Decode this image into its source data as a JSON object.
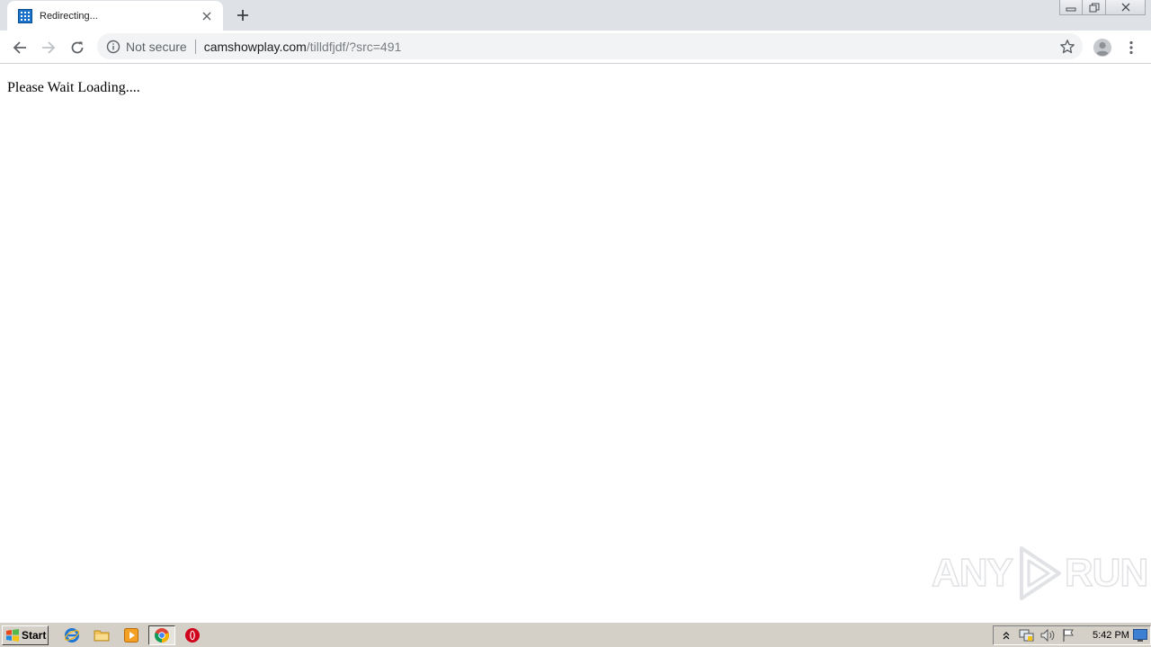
{
  "browser": {
    "tab": {
      "title": "Redirecting...",
      "favicon": "grid-favicon-icon"
    },
    "new_tab_icon": "plus-icon",
    "window_controls": [
      "minimize-icon",
      "restore-icon",
      "close-icon"
    ],
    "toolbar": {
      "back_icon": "arrow-left-icon",
      "forward_icon": "arrow-right-icon",
      "reload_icon": "reload-icon",
      "security_label": "Not secure",
      "url_host": "camshowplay.com",
      "url_path": "/tilldfjdf/?src=491",
      "bookmark_icon": "star-icon",
      "profile_icon": "avatar-icon",
      "menu_icon": "kebab-menu-icon"
    }
  },
  "page": {
    "text": "Please Wait Loading...."
  },
  "watermark": {
    "text_left": "ANY",
    "text_right": "RUN"
  },
  "taskbar": {
    "start_label": "Start",
    "pinned": [
      "ie-icon",
      "folder-icon",
      "media-player-icon",
      "chrome-icon",
      "opera-icon"
    ],
    "tray_icons": [
      "chevron-up-icon",
      "network-icon",
      "speaker-icon",
      "flag-icon"
    ],
    "clock": "5:42 PM"
  },
  "colors": {
    "tabstrip": "#dee1e6",
    "omnibox": "#f1f3f4",
    "taskbar": "#d4d0c8",
    "text_primary": "#202124",
    "text_secondary": "#5f6368"
  }
}
